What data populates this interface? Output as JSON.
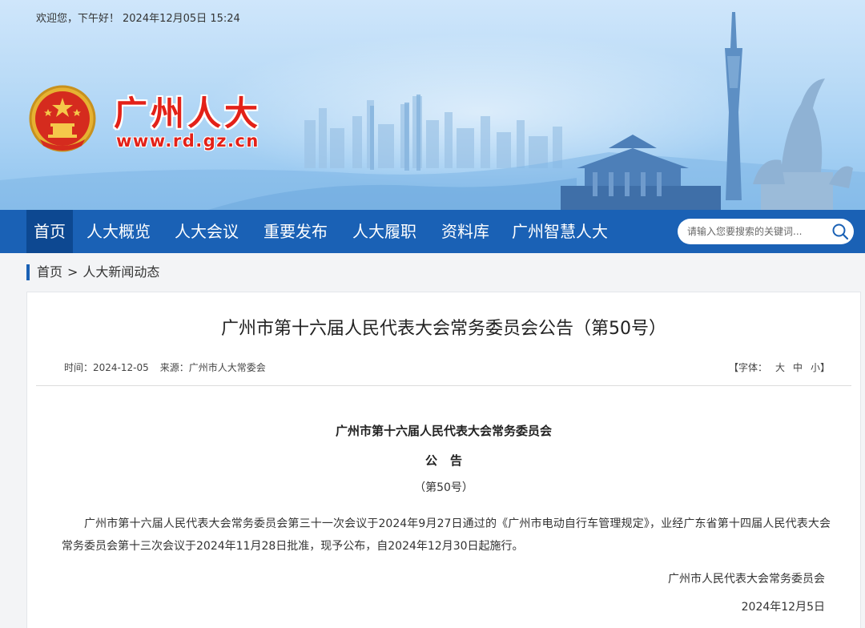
{
  "header": {
    "welcome": "欢迎您，下午好！",
    "datetime": "2024年12月05日 15:24",
    "site_name": "广州人大",
    "site_url": "www.rd.gz.cn"
  },
  "nav": {
    "items": [
      {
        "label": "首页",
        "active": true
      },
      {
        "label": "人大概览"
      },
      {
        "label": "人大会议"
      },
      {
        "label": "重要发布"
      },
      {
        "label": "人大履职"
      },
      {
        "label": "资料库"
      },
      {
        "label": "广州智慧人大"
      }
    ],
    "search_placeholder": "请输入您要搜索的关键词..."
  },
  "breadcrumb": {
    "home": "首页",
    "separator": ">",
    "current": "人大新闻动态"
  },
  "article": {
    "title": "广州市第十六届人民代表大会常务委员会公告（第50号）",
    "time_label": "时间：",
    "time": "2024-12-05",
    "source_label": "来源：",
    "source": "广州市人大常委会",
    "font_label_open": "【字体：",
    "font_large": "大",
    "font_medium": "中",
    "font_small": "小",
    "font_label_close": "】",
    "heading1": "广州市第十六届人民代表大会常务委员会",
    "heading2": "公告",
    "heading3": "（第50号）",
    "paragraph": "广州市第十六届人民代表大会常务委员会第三十一次会议于2024年9月27日通过的《广州市电动自行车管理规定》，业经广东省第十四届人民代表大会常务委员会第十三次会议于2024年11月28日批准，现予公布，自2024年12月30日起施行。",
    "signature": "广州市人民代表大会常务委员会",
    "sign_date": "2024年12月5日"
  },
  "colors": {
    "nav_bg": "#1a61b5",
    "nav_active": "#0d4891",
    "brand_red": "#e32118"
  }
}
